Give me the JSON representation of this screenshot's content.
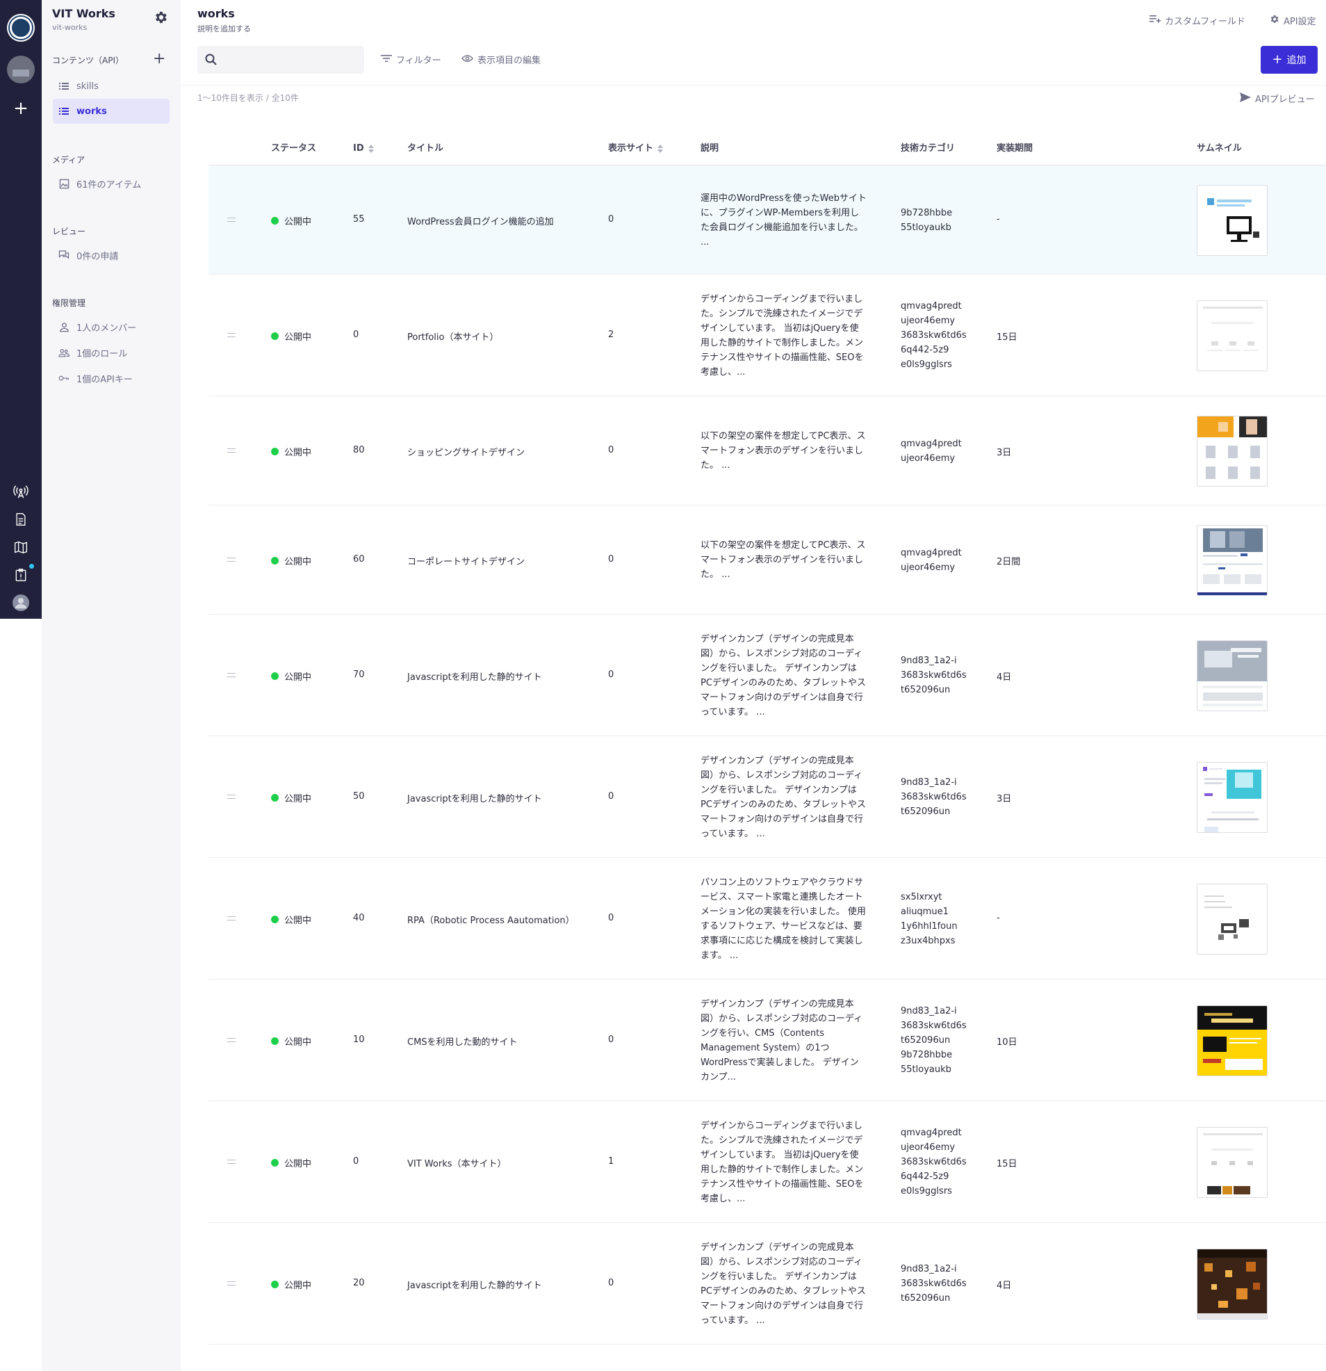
{
  "sidebar": {
    "service_title": "VIT Works",
    "service_sub": "vit-works",
    "contents_header": "コンテンツ（API）",
    "apis": [
      {
        "label": "skills"
      },
      {
        "label": "works"
      }
    ],
    "media_header": "メディア",
    "media_item": "61件のアイテム",
    "review_header": "レビュー",
    "review_item": "0件の申請",
    "auth_header": "権限管理",
    "auth_items": [
      {
        "label": "1人のメンバー"
      },
      {
        "label": "1個のロール"
      },
      {
        "label": "1個のAPIキー"
      }
    ]
  },
  "header": {
    "title": "works",
    "desc_link": "説明を追加する",
    "custom_field": "カスタムフィールド",
    "api_settings": "API設定",
    "search_placeholder": "",
    "filter": "フィルター",
    "edit_columns": "表示項目の編集",
    "add_button": "追加",
    "count_text": "1〜10件目を表示 / 全10件",
    "api_preview": "APIプレビュー"
  },
  "table": {
    "columns": [
      "ステータス",
      "ID",
      "タイトル",
      "表示サイト",
      "説明",
      "技術カテゴリ",
      "実装期間",
      "サムネイル"
    ],
    "rows": [
      {
        "status": "公開中",
        "id": "55",
        "title": "WordPress会員ログイン機能の追加",
        "site": "0",
        "desc": "運用中のWordPressを使ったWebサイトに、プラグインWP-Membersを利用した会員ログイン機能追加を行いました。 ...",
        "tech": "9b728hbbe\n55tloyaukb",
        "period": "-",
        "thumb": "wp-login"
      },
      {
        "status": "公開中",
        "id": "0",
        "title": "Portfolio（本サイト）",
        "site": "2",
        "desc": "デザインからコーディングまで行いました。シンプルで洗練されたイメージでデザインしています。 当初はjQueryを使用した静的サイトで制作しました。メンテナンス性やサイトの描画性能、SEOを考慮し、...",
        "tech": "qmvag4predt\nujeor46emy\n3683skw6td6s\n6q442-5z9\ne0ls9gglsrs",
        "period": "15日",
        "thumb": "portfolio"
      },
      {
        "status": "公開中",
        "id": "80",
        "title": "ショッピングサイトデザイン",
        "site": "0",
        "desc": "以下の架空の案件を想定してPC表示、スマートフォン表示のデザインを行いました。 ...",
        "tech": "qmvag4predt\nujeor46emy",
        "period": "3日",
        "thumb": "shopping"
      },
      {
        "status": "公開中",
        "id": "60",
        "title": "コーポレートサイトデザイン",
        "site": "0",
        "desc": "以下の架空の案件を想定してPC表示、スマートフォン表示のデザインを行いました。 ...",
        "tech": "qmvag4predt\nujeor46emy",
        "period": "2日間",
        "thumb": "corporate"
      },
      {
        "status": "公開中",
        "id": "70",
        "title": "Javascriptを利用した静的サイト",
        "site": "0",
        "desc": "デザインカンプ（デザインの完成見本図）から、レスポンシブ対応のコーディングを行いました。 デザインカンプはPCデザインのみのため、タブレットやスマートフォン向けのデザインは自身で行っています。 ...",
        "tech": "9nd83_1a2-i\n3683skw6td6s\nt652096un",
        "period": "4日",
        "thumb": "js-laptop"
      },
      {
        "status": "公開中",
        "id": "50",
        "title": "Javascriptを利用した静的サイト",
        "site": "0",
        "desc": "デザインカンプ（デザインの完成見本図）から、レスポンシブ対応のコーディングを行いました。 デザインカンプはPCデザインのみのため、タブレットやスマートフォン向けのデザインは自身で行っています。 ...",
        "tech": "9nd83_1a2-i\n3683skw6td6s\nt652096un",
        "period": "3日",
        "thumb": "js-cyan"
      },
      {
        "status": "公開中",
        "id": "40",
        "title": "RPA（Robotic Process Aautomation）",
        "site": "0",
        "desc": "パソコン上のソフトウェアやクラウドサービス、スマート家電と連携したオートメーション化の実装を行いました。 使用するソフトウェア、サービスなどは、要求事項にに応じた構成を検討して実装します。 ...",
        "tech": "sx5lxrxyt\naliuqmue1\n1y6hhl1foun\nz3ux4bhpxs",
        "period": "-",
        "thumb": "rpa"
      },
      {
        "status": "公開中",
        "id": "10",
        "title": "CMSを利用した動的サイト",
        "site": "0",
        "desc": "デザインカンプ（デザインの完成見本図）から、レスポンシブ対応のコーディングを行い、CMS（Contents Management System）の1つWordPressで実装しました。 デザインカンプ...",
        "tech": "9nd83_1a2-i\n3683skw6td6s\nt652096un\n9b728hbbe\n55tloyaukb",
        "period": "10日",
        "thumb": "cms"
      },
      {
        "status": "公開中",
        "id": "0",
        "title": "VIT Works（本サイト）",
        "site": "1",
        "desc": "デザインからコーディングまで行いました。シンプルで洗練されたイメージでデザインしています。 当初はjQueryを使用した静的サイトで制作しました。メンテナンス性やサイトの描画性能、SEOを考慮し、...",
        "tech": "qmvag4predt\nujeor46emy\n3683skw6td6s\n6q442-5z9\ne0ls9gglsrs",
        "period": "15日",
        "thumb": "vitworks"
      },
      {
        "status": "公開中",
        "id": "20",
        "title": "Javascriptを利用した静的サイト",
        "site": "0",
        "desc": "デザインカンプ（デザインの完成見本図）から、レスポンシブ対応のコーディングを行いました。 デザインカンプはPCデザインのみのため、タブレットやスマートフォン向けのデザインは自身で行っています。 ...",
        "tech": "9nd83_1a2-i\n3683skw6td6s\nt652096un",
        "period": "4日",
        "thumb": "night"
      }
    ]
  },
  "colors": {
    "rail": "#21213b",
    "accent": "#3b2ed7",
    "status_green": "#1fcf4a",
    "highlight_row": "#f2fafd"
  }
}
